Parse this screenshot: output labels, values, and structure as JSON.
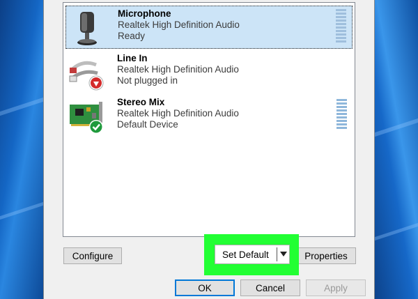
{
  "devices": [
    {
      "name": "Microphone",
      "driver": "Realtek High Definition Audio",
      "status": "Ready",
      "icon": "microphone-icon",
      "selected": true
    },
    {
      "name": "Line In",
      "driver": "Realtek High Definition Audio",
      "status": "Not plugged in",
      "icon": "line-in-jack-icon",
      "badge": "red-down-arrow"
    },
    {
      "name": "Stereo Mix",
      "driver": "Realtek High Definition Audio",
      "status": "Default Device",
      "icon": "sound-card-icon",
      "badge": "green-check"
    }
  ],
  "buttons": {
    "configure": "Configure",
    "set_default": "Set Default",
    "properties": "Properties",
    "ok": "OK",
    "cancel": "Cancel",
    "apply": "Apply"
  },
  "colors": {
    "highlight": "#22ff33",
    "selection": "#cce4f7",
    "focus": "#0078d7"
  }
}
